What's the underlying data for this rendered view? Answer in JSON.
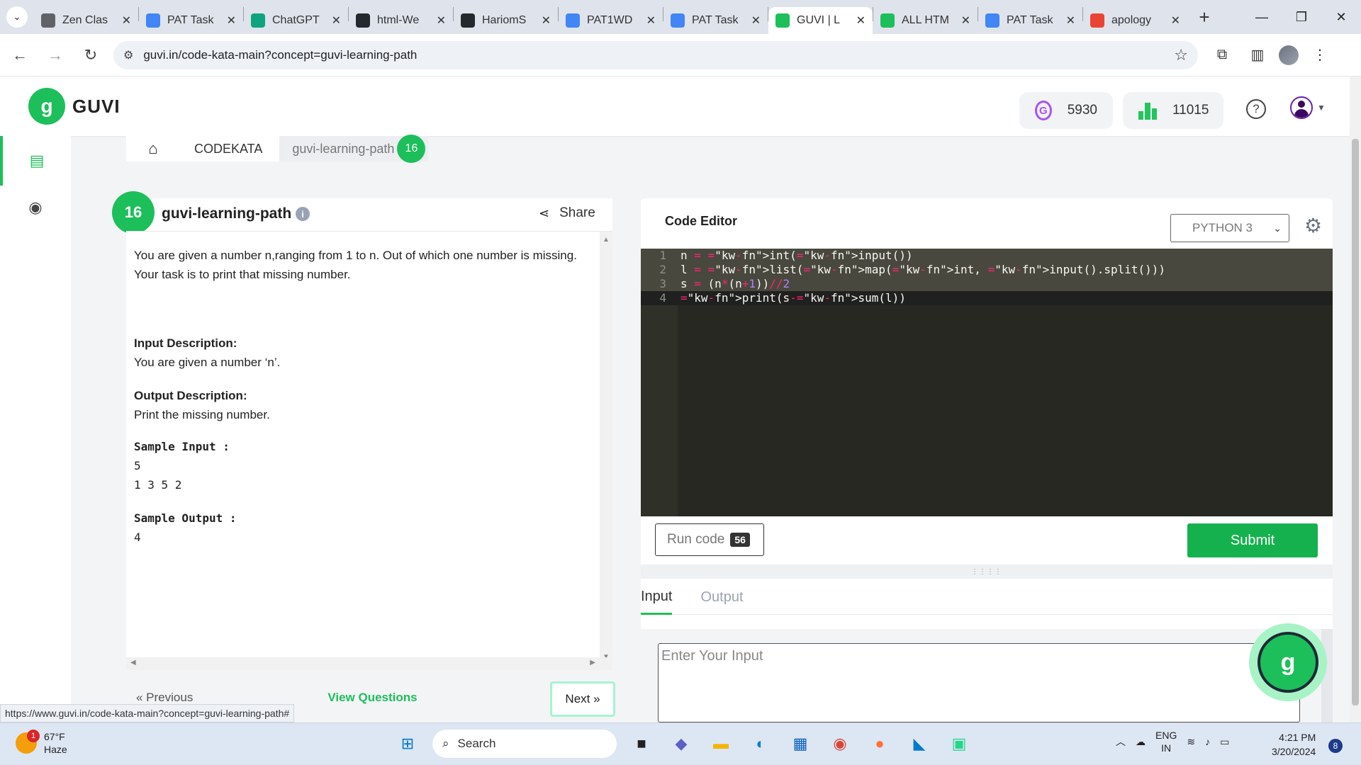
{
  "browser": {
    "tabs": [
      {
        "title": "Zen Clas",
        "favicon": "classroom-icon",
        "color": "#5f6368"
      },
      {
        "title": "PAT Task",
        "favicon": "docs-icon",
        "color": "#4285f4"
      },
      {
        "title": "ChatGPT",
        "favicon": "chatgpt-icon",
        "color": "#10a37f"
      },
      {
        "title": "html-We",
        "favicon": "github-icon",
        "color": "#24292e"
      },
      {
        "title": "HariomS",
        "favicon": "github-icon",
        "color": "#24292e"
      },
      {
        "title": "PAT1WD",
        "favicon": "docs-icon",
        "color": "#4285f4"
      },
      {
        "title": "PAT Task",
        "favicon": "docs-icon",
        "color": "#4285f4"
      },
      {
        "title": "GUVI | L",
        "favicon": "guvi-icon",
        "color": "#1dbf5a",
        "active": true
      },
      {
        "title": "ALL HTM",
        "favicon": "guvi-icon",
        "color": "#1dbf5a"
      },
      {
        "title": "PAT Task",
        "favicon": "docs-icon",
        "color": "#4285f4"
      },
      {
        "title": "apology",
        "favicon": "google-icon",
        "color": "#ea4335"
      }
    ],
    "url": "guvi.in/code-kata-main?concept=guvi-learning-path",
    "status_url": "https://www.guvi.in/code-kata-main?concept=guvi-learning-path#"
  },
  "header": {
    "logo_text": "GUVI",
    "coins": "5930",
    "rank": "11015"
  },
  "breadcrumb": {
    "section": "CODEKATA",
    "path": "guvi-learning-path",
    "count": "16"
  },
  "problem": {
    "number": "16",
    "title": "guvi-learning-path",
    "share_label": "Share",
    "statement": "You are given a number n,ranging from 1 to n. Out of which one number is missing. Your task is to print that missing number.",
    "input_desc_title": "Input Description:",
    "input_desc": "You are given a number ‘n’.",
    "output_desc_title": "Output Description:",
    "output_desc": "Print the missing number.",
    "sample_input_title": "Sample Input :",
    "sample_input_lines": [
      "5",
      "1 3 5 2"
    ],
    "sample_output_title": "Sample Output :",
    "sample_output": "4",
    "prev_label": "«  Previous",
    "view_label": "View Questions",
    "next_label": "Next  »"
  },
  "editor": {
    "title": "Code Editor",
    "language": "PYTHON 3",
    "lines": [
      "n = int(input())",
      "l = list(map(int, input().split()))",
      "s = (n*(n+1))//2",
      "print(s-sum(l))"
    ],
    "run_label": "Run code",
    "run_count": "56",
    "submit_label": "Submit",
    "tab_input": "Input",
    "tab_output": "Output",
    "input_placeholder": "Enter Your Input"
  },
  "taskbar": {
    "weather_temp": "67°F",
    "weather_desc": "Haze",
    "weather_badge": "1",
    "search_label": "Search",
    "lang_top": "ENG",
    "lang_bottom": "IN",
    "time": "4:21 PM",
    "date": "3/20/2024",
    "notif_count": "8"
  }
}
